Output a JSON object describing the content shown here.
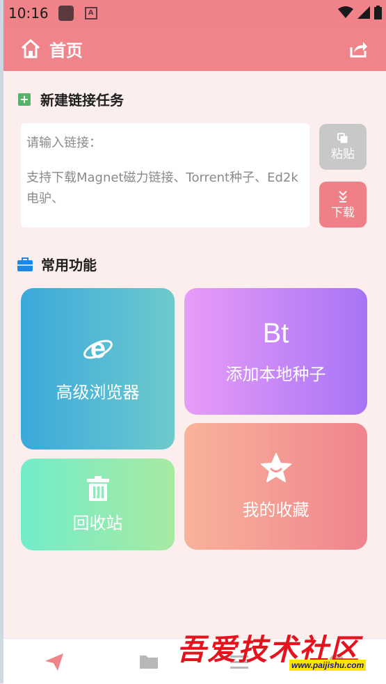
{
  "status_bar": {
    "time": "10:16"
  },
  "app_bar": {
    "title": "首页"
  },
  "new_task": {
    "heading": "新建链接任务",
    "placeholder_line1": "请输入链接：",
    "placeholder_line2": "支持下载Magnet磁力链接、Torrent种子、Ed2k电驴、",
    "paste_label": "粘贴",
    "download_label": "下载"
  },
  "functions": {
    "heading": "常用功能",
    "tiles": [
      {
        "label": "高级浏览器",
        "icon": "ie-browser-icon",
        "colors": [
          "#3aa8dc",
          "#6ecbcb"
        ]
      },
      {
        "label": "添加本地种子",
        "icon_text": "Bt",
        "colors": [
          "#e89cf8",
          "#a774f5"
        ]
      },
      {
        "label": "回收站",
        "icon": "trash-icon",
        "colors": [
          "#72edc9",
          "#a8e9a2"
        ]
      },
      {
        "label": "我的收藏",
        "icon": "star-icon",
        "colors": [
          "#f9b39a",
          "#ef848e"
        ]
      }
    ]
  },
  "nav": {
    "items": [
      "send-icon",
      "folder-icon",
      "menu-icon",
      "settings-icon"
    ]
  },
  "watermark": {
    "text": "吾爱技术社区",
    "url": "www.paijishu.com"
  },
  "colors": {
    "accent": "#f0848b",
    "background": "#fdeeee"
  }
}
